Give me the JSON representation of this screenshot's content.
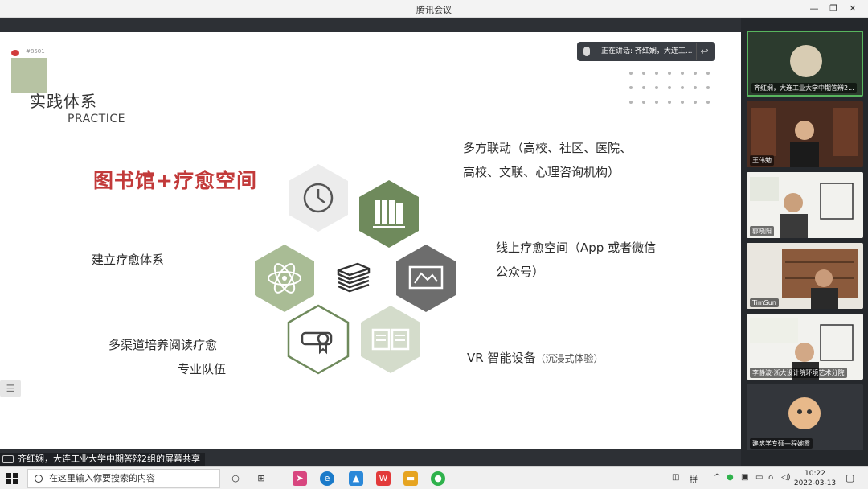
{
  "window": {
    "title": "腾讯会议"
  },
  "speaking": {
    "text": "正在讲话: 齐红娴，大连工...",
    "back_icon": "return-icon"
  },
  "slide": {
    "logo_id": "#8501",
    "title": "实践体系",
    "subtitle": "PRACTICE",
    "headline": "图书馆+疗愈空间",
    "labels": {
      "top_right_1": "多方联动（高校、社区、医院、",
      "top_right_2": "高校、文联、心理咨询机构）",
      "left_mid": "建立疗愈体系",
      "right_mid_1": "线上疗愈空间（App 或者微信",
      "right_mid_2": "公众号）",
      "bottom_left_1": "多渠道培养阅读疗愈",
      "bottom_left_2": "专业队伍",
      "bottom_right": "VR 智能设备",
      "bottom_right_small": "（沉浸式体验）"
    },
    "colors": {
      "red": "#c23a3a",
      "green": "#6f8a5c",
      "light_green": "#a9bc95",
      "gray": "#6d6d6d",
      "light_gray": "#d9d9d9"
    }
  },
  "share_bar": {
    "label": "齐红娴，大连工业大学中期答辩2组的屏幕共享"
  },
  "participants": [
    {
      "name": "齐红娴，大连工业大学中期答辩2...",
      "active": true
    },
    {
      "name": "王伟勉",
      "active": false
    },
    {
      "name": "郭晓阳",
      "active": false
    },
    {
      "name": "TimSun",
      "active": false
    },
    {
      "name": "李静波·浙大设计院环境艺术分院",
      "active": false
    },
    {
      "name": "建筑学专硕—程婉霞",
      "active": false
    }
  ],
  "taskbar": {
    "search_placeholder": "在这里输入你要搜索的内容",
    "ime": "拼",
    "time": "10:22",
    "date": "2022-03-13"
  }
}
